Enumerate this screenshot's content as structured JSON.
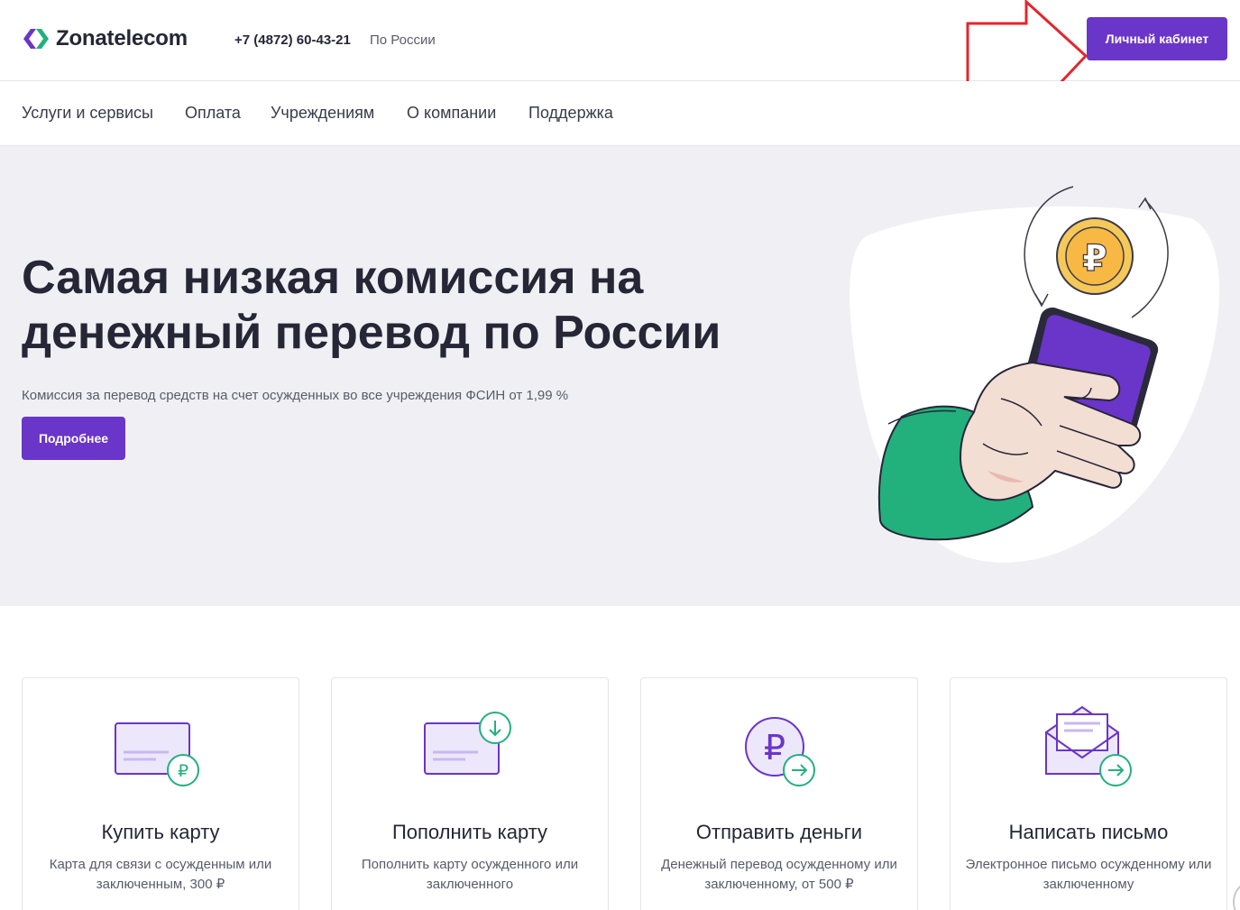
{
  "header": {
    "logo_text": "Zonatelecom",
    "phone": "+7 (4872) 60-43-21",
    "phone_region": "По России",
    "cabinet_label": "Личный кабинет"
  },
  "nav": {
    "items": [
      {
        "label": "Услуги и сервисы"
      },
      {
        "label": "Оплата"
      },
      {
        "label": "Учреждениям"
      },
      {
        "label": "О компании"
      },
      {
        "label": "Поддержка"
      }
    ]
  },
  "hero": {
    "title": "Самая низкая комиссия на денежный перевод по России",
    "subtitle": "Комиссия за перевод средств на счет осужденных во все учреждения ФСИН от 1,99 %",
    "button_label": "Подробнее"
  },
  "cards": [
    {
      "title": "Купить карту",
      "desc": "Карта для связи с осужденным или заключенным, 300 ₽",
      "icon": "card-ruble-icon"
    },
    {
      "title": "Пополнить карту",
      "desc": "Пополнить карту осужденного или заключенного",
      "icon": "card-download-icon"
    },
    {
      "title": "Отправить деньги",
      "desc": "Денежный перевод осужденному или заключенному, от 500 ₽",
      "icon": "ruble-send-icon"
    },
    {
      "title": "Написать письмо",
      "desc": "Электронное письмо осужденному или заключенному",
      "icon": "envelope-send-icon"
    }
  ],
  "colors": {
    "brand_purple": "#6a35c9",
    "brand_green": "#22b07d",
    "annotation_red": "#e3262e",
    "hero_bg": "#f0f0f4"
  }
}
